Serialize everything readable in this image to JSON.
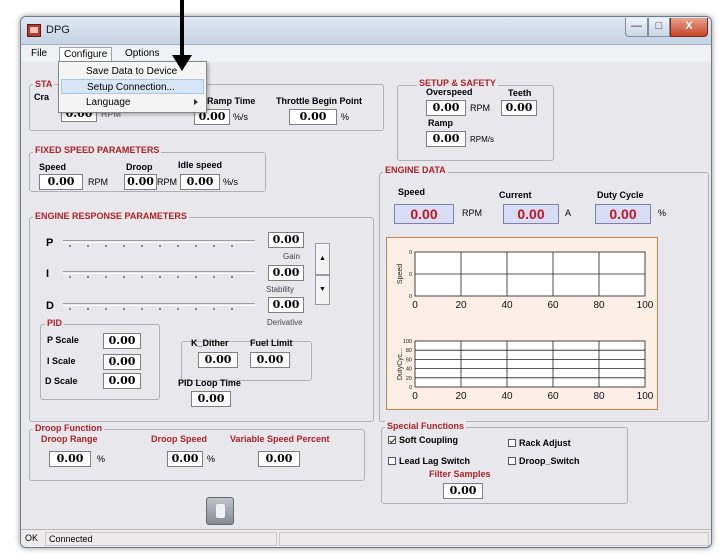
{
  "window": {
    "title": "DPG",
    "controls": {
      "minimize": "—",
      "maximize": "□",
      "close": "X"
    }
  },
  "menu": {
    "file": "File",
    "configure": "Configure",
    "options": "Options",
    "dropdown": [
      "Save Data to Device",
      "Setup Connection...",
      "Language"
    ]
  },
  "start_group": {
    "title": "STA",
    "crank_label": "Cra",
    "crank_value": "0.00",
    "crank_unit": "RPM",
    "ramp_time_label": "Ramp Time",
    "ramp_time_value": "0.00",
    "ramp_time_unit": "%/s",
    "throttle_label": "Throttle Begin Point",
    "throttle_value": "0.00",
    "throttle_unit": "%"
  },
  "setup_safety": {
    "title": "SETUP & SAFETY",
    "overspeed_label": "Overspeed",
    "overspeed_value": "0.00",
    "overspeed_unit": "RPM",
    "teeth_label": "Teeth",
    "teeth_value": "0.00",
    "ramp_label": "Ramp",
    "ramp_value": "0.00",
    "ramp_unit": "RPM/s"
  },
  "fixed_speed": {
    "title": "FIXED SPEED PARAMETERS",
    "speed_label": "Speed",
    "speed_value": "0.00",
    "speed_unit": "RPM",
    "droop_label": "Droop",
    "droop_value": "0.00",
    "droop_unit": "RPM",
    "idle_label": "Idle speed",
    "idle_value": "0.00",
    "idle_unit": "%/s"
  },
  "engine_response": {
    "title": "ENGINE RESPONSE PARAMETERS",
    "p_label": "P",
    "i_label": "I",
    "d_label": "D",
    "gain_value": "0.00",
    "gain_label": "Gain",
    "stability_value": "0.00",
    "stability_label": "Stability",
    "derivative_value": "0.00",
    "derivative_label": "Derivative",
    "spin_up": "▲",
    "spin_down": "▼"
  },
  "pid": {
    "title": "PID",
    "p_scale_label": "P Scale",
    "p_scale_value": "0.00",
    "i_scale_label": "I Scale",
    "i_scale_value": "0.00",
    "d_scale_label": "D Scale",
    "d_scale_value": "0.00",
    "k_dither_label": "K_Dither",
    "k_dither_value": "0.00",
    "fuel_limit_label": "Fuel Limit",
    "fuel_limit_value": "0.00",
    "loop_time_label": "PID Loop Time",
    "loop_time_value": "0.00"
  },
  "engine_data": {
    "title": "ENGINE DATA",
    "speed_label": "Speed",
    "speed_value": "0.00",
    "speed_unit": "RPM",
    "current_label": "Current",
    "current_value": "0.00",
    "current_unit": "A",
    "duty_label": "Duty Cycle",
    "duty_value": "0.00",
    "duty_unit": "%"
  },
  "chart_data": [
    {
      "type": "line",
      "ylabel": "Speed",
      "xlim": [
        0,
        100
      ],
      "x_ticks": [
        "0",
        "20",
        "40",
        "60",
        "80",
        "100"
      ],
      "y_ticks": [
        "0",
        "0",
        "0"
      ],
      "grid": true,
      "series": []
    },
    {
      "type": "line",
      "ylabel": "DutyCyc...",
      "xlim": [
        0,
        100
      ],
      "ylim": [
        0,
        100
      ],
      "x_ticks": [
        "0",
        "20",
        "40",
        "60",
        "80",
        "100"
      ],
      "y_ticks": [
        "100",
        "80",
        "60",
        "40",
        "20",
        "0"
      ],
      "grid": true,
      "series": []
    }
  ],
  "droop": {
    "title": "Droop Function",
    "range_label": "Droop Range",
    "range_value": "0.00",
    "range_unit": "%",
    "speed_label": "Droop Speed",
    "speed_value": "0.00",
    "speed_unit": "%",
    "variable_label": "Variable Speed Percent",
    "variable_value": "0.00"
  },
  "special": {
    "title": "Special Functions",
    "soft_coupling": "Soft Coupling",
    "soft_coupling_checked": true,
    "rack_adjust": "Rack Adjust",
    "lead_lag": "Lead Lag Switch",
    "droop_switch": "Droop_Switch",
    "filter_label": "Filter Samples",
    "filter_value": "0.00"
  },
  "status": {
    "left": "OK",
    "connection": "Connected"
  }
}
